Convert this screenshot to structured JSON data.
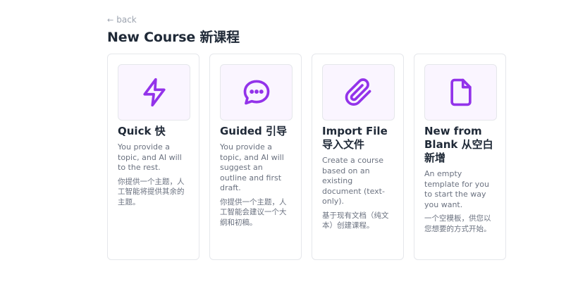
{
  "header": {
    "back_label": "back",
    "title": "New Course 新课程"
  },
  "cards": [
    {
      "icon": "lightning-icon",
      "title": "Quick 快",
      "description": "You provide a topic, and AI will to the rest.",
      "description_cn": "你提供一个主题，人工智能将提供其余的主题。"
    },
    {
      "icon": "chat-bubble-icon",
      "title": "Guided 引导",
      "description": "You provide a topic, and AI will suggest an outline and first draft.",
      "description_cn": "你提供一个主题，人工智能会建议一个大纲和初稿。"
    },
    {
      "icon": "paperclip-icon",
      "title": "Import File 导入文件",
      "description": "Create a course based on an existing document (text-only).",
      "description_cn": "基于现有文档（纯文本）创建课程。"
    },
    {
      "icon": "blank-document-icon",
      "title": "New from Blank 从空白新增",
      "description": "An empty template for you to start the way you want.",
      "description_cn": "一个空模板，供您以您想要的方式开始。"
    }
  ],
  "colors": {
    "accent": "#9333ea",
    "icon_bg": "#faf5ff",
    "border": "#e5e7eb"
  }
}
